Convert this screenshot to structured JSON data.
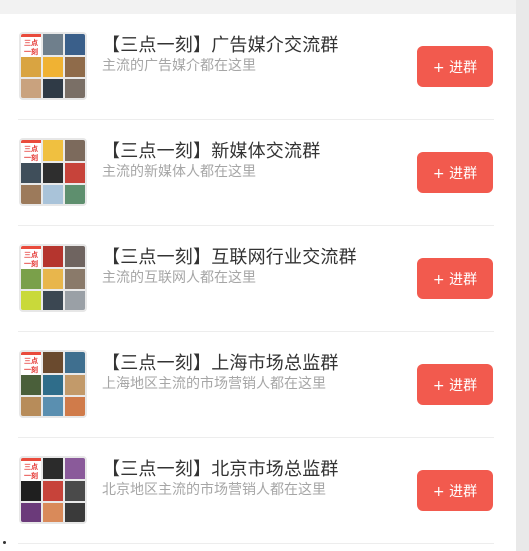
{
  "groups": [
    {
      "title": "【三点一刻】广告媒介交流群",
      "subtitle": "主流的广告媒介都在这里",
      "button": "+ 进群",
      "tiles": [
        "#e94b3c",
        "#6f7f8c",
        "#3a5f8a",
        "#d9a441",
        "#f0b233",
        "#8f6b4a",
        "#c9a27e",
        "#2f3a46",
        "#7a6f66"
      ]
    },
    {
      "title": "【三点一刻】新媒体交流群",
      "subtitle": "主流的新媒体人都在这里",
      "button": "+ 进群",
      "tiles": [
        "#e94b3c",
        "#f0c040",
        "#7c6a5c",
        "#3f4e5a",
        "#2e2e2e",
        "#c7433a",
        "#9c7a5b",
        "#a9c3d9",
        "#5e8f6e"
      ]
    },
    {
      "title": "【三点一刻】互联网行业交流群",
      "subtitle": "主流的互联网人都在这里",
      "button": "+ 进群",
      "tiles": [
        "#e94b3c",
        "#b5352e",
        "#6f6460",
        "#7aa04a",
        "#e8b64c",
        "#8a7a6a",
        "#c9d93a",
        "#3b4752",
        "#9aa0a6"
      ]
    },
    {
      "title": "【三点一刻】上海市场总监群",
      "subtitle": "上海地区主流的市场营销人都在这里",
      "button": "+ 进群",
      "tiles": [
        "#e94b3c",
        "#6a4a2e",
        "#3f6f8f",
        "#4a5f3a",
        "#2f6d8a",
        "#c29a6a",
        "#b78c5a",
        "#5a8fb0",
        "#d07b4a"
      ]
    },
    {
      "title": "【三点一刻】北京市场总监群",
      "subtitle": "北京地区主流的市场营销人都在这里",
      "button": "+ 进群",
      "tiles": [
        "#e94b3c",
        "#2b2b2b",
        "#8a5a9a",
        "#1f1f1f",
        "#c7433a",
        "#4a4a4a",
        "#6b3a7a",
        "#d98a5a",
        "#3a3a3a"
      ]
    }
  ],
  "logo_text": [
    "三点",
    "一刻"
  ]
}
